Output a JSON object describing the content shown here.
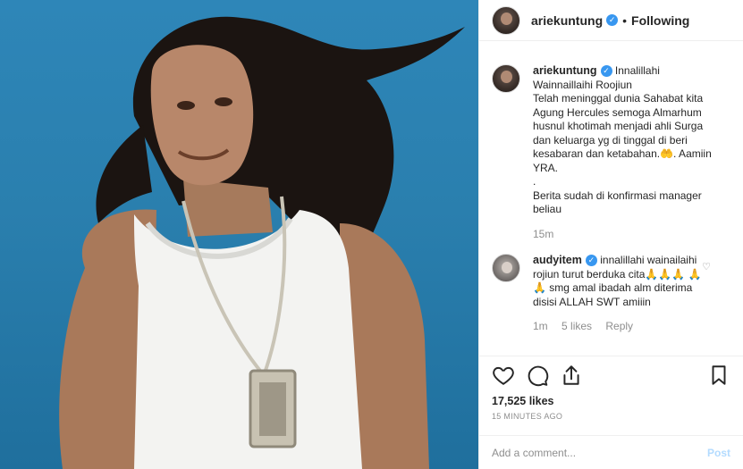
{
  "post": {
    "author": "ariekuntung",
    "follow_status": "Following",
    "dot": "•"
  },
  "caption": {
    "username": "ariekuntung",
    "line1": "Innalillahi Wainnaillaihi Roojiun",
    "line2": "Telah meninggal dunia Sahabat kita Agung Hercules semoga Almarhum husnul khotimah menjadi ahli Surga dan keluarga yg di tinggal di beri kesabaran dan ketabahan.🤲. Aamiin YRA.",
    "line3": ".",
    "line4": "Berita sudah di konfirmasi manager beliau",
    "time": "15m"
  },
  "reply": {
    "username": "audyitem",
    "text": "innalillahi wainailaihi rojiun turut berduka cita🙏🙏🙏 🙏🙏 smg amal ibadah alm diterima disisi ALLAH SWT amiiin",
    "time": "1m",
    "likes": "5 likes",
    "reply_label": "Reply"
  },
  "stats": {
    "likes": "17,525 likes",
    "posted": "15 MINUTES AGO"
  },
  "comment_box": {
    "placeholder": "Add a comment...",
    "post_label": "Post"
  },
  "colors": {
    "verified": "#3897f0",
    "post_disabled": "#b3dbff",
    "photo_background": "#2a7fae"
  },
  "icons": [
    "verified-badge-icon",
    "heart-icon",
    "comment-icon",
    "share-icon",
    "bookmark-icon"
  ]
}
